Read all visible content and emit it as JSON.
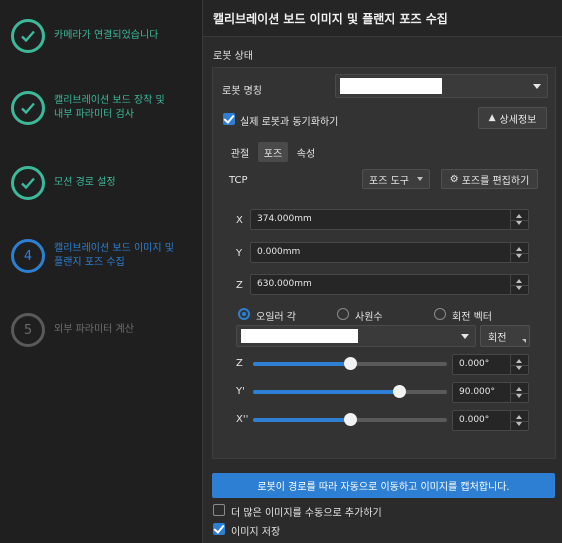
{
  "steps": [
    {
      "label": "카메라가 연결되었습니다",
      "status": "done"
    },
    {
      "label": "캘리브레이션 보드 장착 및\n내부 파라미터 검사",
      "status": "done"
    },
    {
      "label": "모션 경로 설정",
      "status": "done"
    },
    {
      "label": "캘리브레이션 보드 이미지 및\n플랜지 포즈 수집",
      "status": "active",
      "number": "4"
    },
    {
      "label": "외부 파라미터 계산",
      "status": "pending",
      "number": "5"
    }
  ],
  "header": {
    "title": "캘리브레이션 보드 이미지 및 플랜지 포즈 수집"
  },
  "robot_state": {
    "title": "로봇 상태",
    "name_label": "로봇 명칭",
    "name_value": "",
    "sync_label": "실제 로봇과 동기화하기",
    "sync_checked": true,
    "details_button": "상세정보",
    "tabs": [
      "관절",
      "포즈",
      "속성"
    ],
    "active_tab": "포즈",
    "tcp_label": "TCP",
    "pose_tool_select": "포즈 도구",
    "edit_pose_button": "포즈를 편집하기",
    "x_label": "X",
    "x_value": "374.000mm",
    "y_label": "Y",
    "y_value": "0.000mm",
    "z_label": "Z",
    "z_value": "630.000mm",
    "rotation_modes": [
      "오일러 각",
      "사원수",
      "회전 벡터"
    ],
    "selected_rotation_mode": "오일러 각",
    "euler_select_value": "",
    "rotate_button": "회전",
    "z_rot_label": "Z",
    "z_rot_value": "0.000°",
    "z_rot_level": 0.5,
    "y_rot_label": "Y'",
    "y_rot_value": "90.000°",
    "y_rot_level": 0.75,
    "x_rot_label": "X''",
    "x_rot_value": "0.000°",
    "x_rot_level": 0.5
  },
  "capture_button": "로봇이 경로를 따라 자동으로 이동하고 이미지를 캡처합니다.",
  "manual_add_label": "더 많은 이미지를 수동으로 추가하기",
  "manual_add_checked": false,
  "save_images_label": "이미지 저장",
  "save_images_checked": true,
  "colors": {
    "accent": "#2d7fd3",
    "done": "#3cb99a"
  }
}
